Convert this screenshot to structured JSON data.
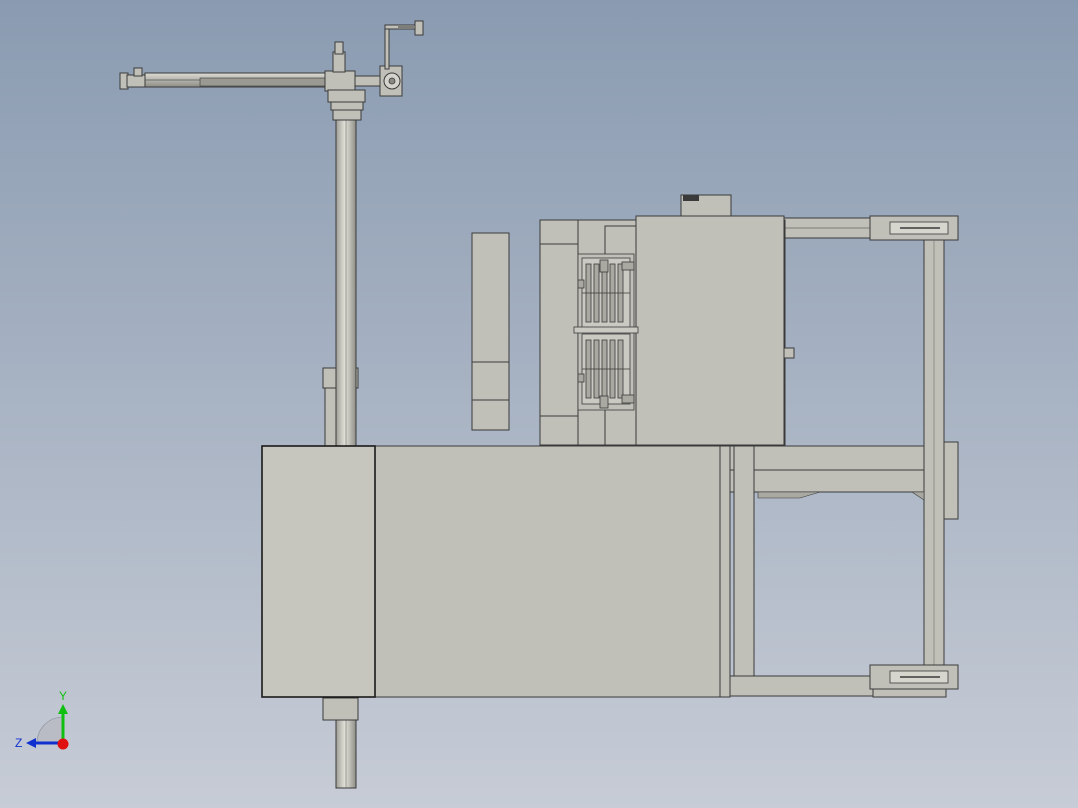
{
  "viewport": {
    "background_top": "#8a9bb1",
    "background_bottom": "#c7ccd6"
  },
  "colors": {
    "part_fill": "#c0c0b8",
    "part_fill_light": "#cacac2",
    "part_fill_dark": "#a9a9a1",
    "edge": "#3a3a3a",
    "x_axis": "#e01010",
    "y_axis": "#10c010",
    "z_axis": "#1030d0"
  },
  "triad": {
    "y_label": "Y",
    "z_label": "Z"
  },
  "components": {
    "arm": "horizontal-arm",
    "column": "vertical-column",
    "base": "machine-base",
    "head": "die-head",
    "frame": "right-frame",
    "block": "separate-block"
  }
}
